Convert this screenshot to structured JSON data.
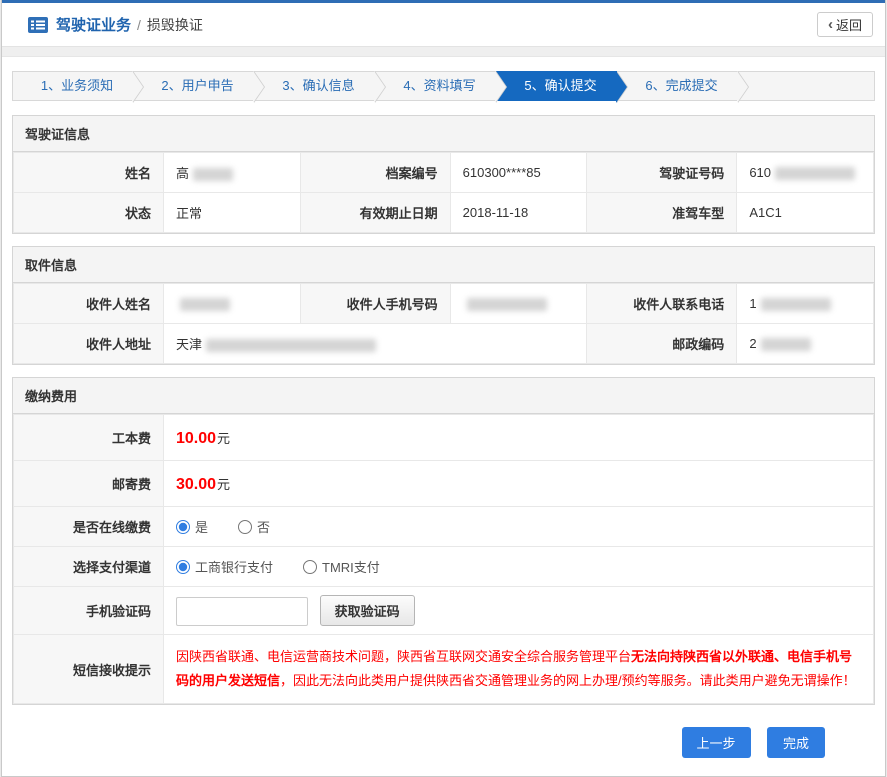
{
  "header": {
    "title": "驾驶证业务",
    "separator": "/",
    "subtitle": "损毁换证",
    "back_chevron": "‹",
    "back_label": "返回"
  },
  "steps": {
    "active_index": 4,
    "active_color": "#1569c0",
    "items": [
      {
        "label": "1、业务须知"
      },
      {
        "label": "2、用户申告"
      },
      {
        "label": "3、确认信息"
      },
      {
        "label": "4、资料填写"
      },
      {
        "label": "5、确认提交"
      },
      {
        "label": "6、完成提交"
      }
    ]
  },
  "license_section": {
    "title": "驾驶证信息",
    "name_label": "姓名",
    "name_value": "高",
    "archive_label": "档案编号",
    "archive_value": "610300****85",
    "license_no_label": "驾驶证号码",
    "license_no_value": "610",
    "status_label": "状态",
    "status_value": "正常",
    "expiry_label": "有效期止日期",
    "expiry_value": "2018-11-18",
    "class_label": "准驾车型",
    "class_value": "A1C1"
  },
  "pickup_section": {
    "title": "取件信息",
    "recipient_name_label": "收件人姓名",
    "recipient_name_value": "",
    "recipient_mobile_label": "收件人手机号码",
    "recipient_mobile_value": "",
    "recipient_tel_label": "收件人联系电话",
    "recipient_tel_value": "1",
    "address_label": "收件人地址",
    "address_value": "天津",
    "postcode_label": "邮政编码",
    "postcode_value": "2"
  },
  "fees_section": {
    "title": "缴纳费用",
    "cost_label": "工本费",
    "cost_value": "10.00",
    "cost_unit": "元",
    "postage_label": "邮寄费",
    "postage_value": "30.00",
    "postage_unit": "元",
    "online_label": "是否在线缴费",
    "online_yes": "是",
    "online_no": "否",
    "online_selected": "是",
    "channel_label": "选择支付渠道",
    "channel_icbc": "工商银行支付",
    "channel_tmri": "TMRI支付",
    "channel_selected": "工商银行支付",
    "captcha_label": "手机验证码",
    "captcha_value": "",
    "captcha_button": "获取验证码",
    "sms_label": "短信接收提示",
    "sms_text_1": "因陕西省联通、电信运营商技术问题，陕西省互联网交通安全综合服务管理平台",
    "sms_text_bold": "无法向持陕西省以外联通、电信手机号码的用户发送短信",
    "sms_text_2": "，因此无法向此类用户提供陕西省交通管理业务的网上办理/预约等服务。请此类用户避免无谓操作！"
  },
  "actions": {
    "prev_label": "上一步",
    "finish_label": "完成"
  }
}
